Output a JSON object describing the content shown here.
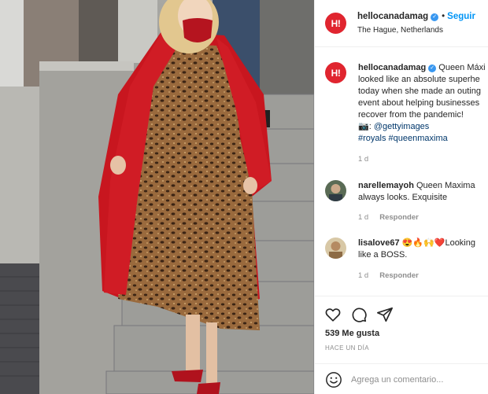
{
  "post": {
    "username": "hellocanadamag",
    "avatar_text": "H!",
    "verified_icon": "verified-badge-icon",
    "follow_label": "Seguir",
    "location": "The Hague, Netherlands"
  },
  "caption": {
    "username": "hellocanadamag",
    "lines": [
      "Queen Máxi",
      "looked like an absolute superhe",
      "today when she made an outing",
      "event about helping businesses",
      "recover from the pandemic!"
    ],
    "credit_icon": "camera-emoji",
    "credit": "@gettyimages",
    "hashtags": "#royals #queenmaxima",
    "time": "1 d"
  },
  "comments": [
    {
      "username": "narellemayoh",
      "text_line1": "Queen Maxima",
      "text_line2": "always looks. Exquisite",
      "time": "1 d",
      "reply_label": "Responder"
    },
    {
      "username": "lisalove67",
      "emojis": "😍🔥🙌❤️",
      "text_line1": "Looking",
      "text_line2": "like a BOSS.",
      "time": "1 d",
      "reply_label": "Responder"
    }
  ],
  "actions": {
    "like_icon": "heart-icon",
    "comment_icon": "comment-bubble-icon",
    "share_icon": "send-icon",
    "likes_text": "539 Me gusta",
    "posted_time": "HACE UN DÍA"
  },
  "comment_box": {
    "emoji_icon": "emoji-smiley-icon",
    "placeholder": "Agrega un comentario..."
  },
  "colors": {
    "brand_red": "#e0252f",
    "link_blue": "#0095f6",
    "hashtag_blue": "#00376b",
    "muted_gray": "#8e8e8e",
    "coat_red": "#c8161f"
  }
}
